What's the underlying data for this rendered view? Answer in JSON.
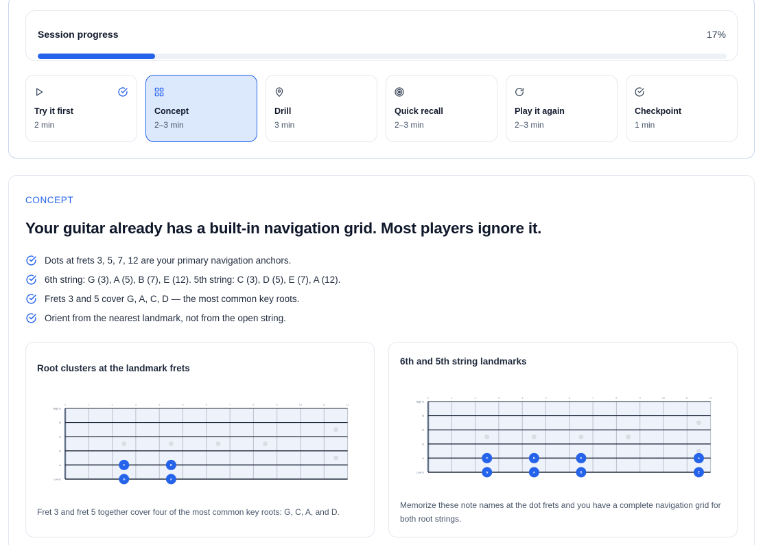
{
  "progress": {
    "title": "Session progress",
    "percent_label": "17%",
    "fraction": 0.17
  },
  "steps": [
    {
      "icon": "play-icon",
      "title": "Try it first",
      "duration": "2 min",
      "completed": true,
      "active": false
    },
    {
      "icon": "grid-icon",
      "title": "Concept",
      "duration": "2–3 min",
      "completed": false,
      "active": true
    },
    {
      "icon": "map-pin-icon",
      "title": "Drill",
      "duration": "3 min",
      "completed": false,
      "active": false
    },
    {
      "icon": "target-icon",
      "title": "Quick recall",
      "duration": "2–3 min",
      "completed": false,
      "active": false
    },
    {
      "icon": "refresh-icon",
      "title": "Play it again",
      "duration": "2–3 min",
      "completed": false,
      "active": false
    },
    {
      "icon": "check-circle-icon",
      "title": "Checkpoint",
      "duration": "1 min",
      "completed": false,
      "active": false
    }
  ],
  "concept": {
    "eyebrow": "CONCEPT",
    "headline": "Your guitar already has a built-in navigation grid. Most players ignore it.",
    "bullets": [
      "Dots at frets 3, 5, 7, 12 are your primary navigation anchors.",
      "6th string: G (3), A (5), B (7), E (12). 5th string: C (3), D (5), E (7), A (12).",
      "Frets 3 and 5 cover G, A, C, D — the most common key roots.",
      "Orient from the nearest landmark, not from the open string."
    ]
  },
  "fretboard_labels": {
    "frets": [
      "0",
      "1",
      "2",
      "3",
      "4",
      "5",
      "6",
      "7",
      "8",
      "9",
      "10",
      "11",
      "12"
    ],
    "strings": [
      "High E",
      "B",
      "G",
      "D",
      "A",
      "Low E"
    ]
  },
  "panels": [
    {
      "title": "Root clusters at the landmark frets",
      "caption": "Fret 3 and fret 5 together cover four of the most common key roots: G, C, A, and D.",
      "notes": [
        {
          "string": "A",
          "fret": 3,
          "label": "C"
        },
        {
          "string": "A",
          "fret": 5,
          "label": "D"
        },
        {
          "string": "Low E",
          "fret": 3,
          "label": "G"
        },
        {
          "string": "Low E",
          "fret": 5,
          "label": "A"
        }
      ]
    },
    {
      "title": "6th and 5th string landmarks",
      "caption": "Memorize these note names at the dot frets and you have a complete navigation grid for both root strings.",
      "notes": [
        {
          "string": "A",
          "fret": 3,
          "label": "C"
        },
        {
          "string": "A",
          "fret": 5,
          "label": "D"
        },
        {
          "string": "A",
          "fret": 7,
          "label": "E"
        },
        {
          "string": "A",
          "fret": 12,
          "label": "A"
        },
        {
          "string": "Low E",
          "fret": 3,
          "label": "G"
        },
        {
          "string": "Low E",
          "fret": 5,
          "label": "A"
        },
        {
          "string": "Low E",
          "fret": 7,
          "label": "B"
        },
        {
          "string": "Low E",
          "fret": 12,
          "label": "E"
        }
      ]
    }
  ],
  "colors": {
    "accent": "#2563eb",
    "active_bg": "#dce8fc",
    "board_bg": "#eef2fa",
    "inlay": "#d9dde4"
  }
}
